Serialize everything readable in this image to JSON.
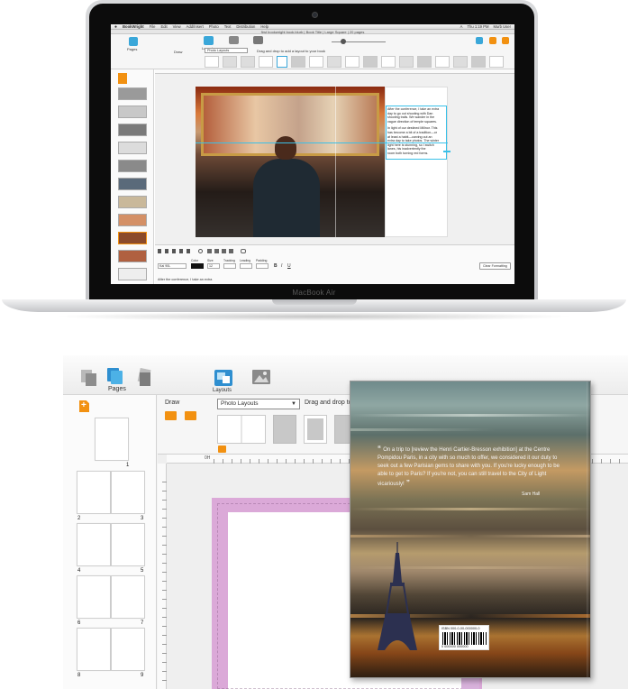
{
  "laptop": {
    "brand": "MacBook Air",
    "menubar": {
      "apple": "",
      "items": [
        "BookWright",
        "File",
        "Edit",
        "View",
        "Add/Insert",
        "Photo",
        "Text",
        "Distribution",
        "Help"
      ],
      "right": [
        "A",
        "Thu 1:19 PM",
        "Murb User"
      ]
    },
    "window_title": "first bookwright book.blurb | Book Title | Large Square | 20 pages",
    "toolbar": {
      "pages_label": "Pages",
      "layouts_label": "Layouts",
      "draw_label": "Draw",
      "dropdown_value": "Photo Layouts",
      "hint": "Drag and drop to add a layout to your book"
    },
    "body_text": [
      "After the conference, I take an extra",
      "day to go out shooting with Dan",
      "shooting trails. We wander in the",
      "vague direction of temple squares.",
      "",
      "In light of our destined Millnor. This",
      "has become a bit of a tradition—or",
      "at least a habit—carving out an",
      "extra day to take photos. The winter",
      "light here is stunning, so I switch",
      "lanes, his inadvertently the",
      "room both turning red forms."
    ],
    "format_bar": {
      "font": "Kai 90L",
      "size": "12",
      "clear_button": "Clear Formatting",
      "labels": [
        "Color",
        "Size",
        "Tracking",
        "Leading",
        "Padding"
      ],
      "bold": "B",
      "italic": "I",
      "underline": "U"
    },
    "status_text": "After the conference, I take an extra"
  },
  "zoom": {
    "pages_tab": "Pages",
    "layouts_tab": "Layouts",
    "draw_label": "Draw",
    "dropdown_value": "Photo Layouts",
    "hint": "Drag and drop to",
    "page_numbers": [
      "1",
      "2",
      "3",
      "4",
      "5",
      "6",
      "7",
      "8",
      "9"
    ],
    "ruler_label": "0H"
  },
  "book_cover": {
    "quote": "On a trip to [review the Henri Cartier-Bresson exhibition] at the Centre Pompidou Paris, in a city with so much to offer, we considered it our duty to seek out a few Parisian gems to share with you. If you're lucky enough to be able to get to Paris? If you're not, you can still travel to the City of Light vicariously!",
    "author": "Sam Hall",
    "isbn": "ISBN 000-0-00-000000-0",
    "barcode_number": "0 000000 000000"
  },
  "colors": {
    "accent": "#3aa7d9",
    "orange": "#f29111",
    "pink_page": "#dba9d8",
    "guide": "#3ac0e8"
  }
}
